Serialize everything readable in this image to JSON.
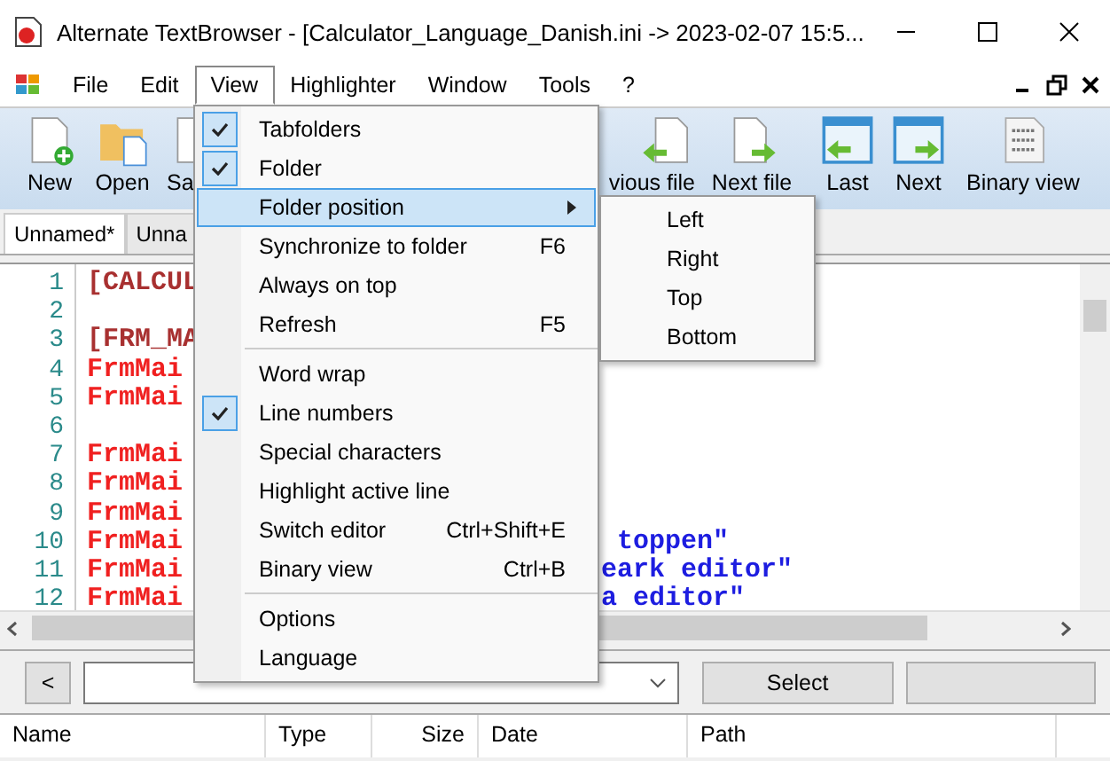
{
  "window": {
    "title": "Alternate TextBrowser - [Calculator_Language_Danish.ini -> 2023-02-07 15:5..."
  },
  "menubar": [
    {
      "label": "File",
      "selected": false
    },
    {
      "label": "Edit",
      "selected": false
    },
    {
      "label": "View",
      "selected": true
    },
    {
      "label": "Highlighter",
      "selected": false
    },
    {
      "label": "Window",
      "selected": false
    },
    {
      "label": "Tools",
      "selected": false
    },
    {
      "label": "?",
      "selected": false
    }
  ],
  "toolbar": [
    {
      "label": "New",
      "kind": "new"
    },
    {
      "label": "Open",
      "kind": "open"
    },
    {
      "label": "Sa",
      "kind": "doc"
    },
    {
      "label": "vious file",
      "kind": "prev"
    },
    {
      "label": "Next file",
      "kind": "next"
    },
    {
      "label": "Last",
      "kind": "last"
    },
    {
      "label": "Next",
      "kind": "nextw"
    },
    {
      "label": "Binary view",
      "kind": "binary"
    }
  ],
  "tabs": [
    {
      "label": "Unnamed*",
      "selected": true
    },
    {
      "label": "Unna",
      "selected": false
    }
  ],
  "editor": {
    "lines": [
      {
        "number": "1",
        "kind": "section",
        "left": "[CALCUL"
      },
      {
        "number": "2",
        "kind": "blank"
      },
      {
        "number": "3",
        "kind": "section",
        "left": "[FRM_MA"
      },
      {
        "number": "4",
        "kind": "key",
        "left": "FrmMai"
      },
      {
        "number": "5",
        "kind": "key",
        "left": "FrmMai"
      },
      {
        "number": "6",
        "kind": "blank"
      },
      {
        "number": "7",
        "kind": "key",
        "left": "FrmMai"
      },
      {
        "number": "8",
        "kind": "key",
        "left": "FrmMai"
      },
      {
        "number": "9",
        "kind": "key",
        "left": "FrmMai"
      },
      {
        "number": "10",
        "kind": "key",
        "left": "FrmMai",
        "right": " toppen\""
      },
      {
        "number": "11",
        "kind": "key",
        "left": "FrmMai",
        "right": "eark editor\""
      },
      {
        "number": "12",
        "kind": "key",
        "left": "FrmMai",
        "right": "a editor\""
      }
    ]
  },
  "view_menu": [
    {
      "kind": "check",
      "label": "Tabfolders",
      "checked": true,
      "selected": false
    },
    {
      "kind": "check",
      "label": "Folder",
      "checked": true,
      "selected": false
    },
    {
      "kind": "submenu",
      "label": "Folder position",
      "checked": false,
      "selected": true
    },
    {
      "kind": "check",
      "label": "Synchronize to folder",
      "shortcut": "F6",
      "checked": false,
      "selected": false
    },
    {
      "kind": "check",
      "label": "Always on top",
      "checked": false,
      "selected": false
    },
    {
      "kind": "check",
      "label": "Refresh",
      "shortcut": "F5",
      "checked": false,
      "selected": false
    },
    {
      "kind": "separator"
    },
    {
      "kind": "check",
      "label": "Word wrap",
      "checked": false,
      "selected": false
    },
    {
      "kind": "check",
      "label": "Line numbers",
      "checked": true,
      "selected": false
    },
    {
      "kind": "check",
      "label": "Special characters",
      "checked": false,
      "selected": false
    },
    {
      "kind": "check",
      "label": "Highlight active line",
      "checked": false,
      "selected": false
    },
    {
      "kind": "check",
      "label": "Switch editor",
      "shortcut": "Ctrl+Shift+E",
      "checked": false,
      "selected": false
    },
    {
      "kind": "check",
      "label": "Binary view",
      "shortcut": "Ctrl+B",
      "checked": false,
      "selected": false
    },
    {
      "kind": "separator"
    },
    {
      "kind": "check",
      "label": "Options",
      "checked": false,
      "selected": false
    },
    {
      "kind": "check",
      "label": "Language",
      "checked": false,
      "selected": false
    }
  ],
  "position_submenu": [
    {
      "label": "Left"
    },
    {
      "label": "Right"
    },
    {
      "label": "Top"
    },
    {
      "label": "Bottom"
    }
  ],
  "folder_bar": {
    "back": "<",
    "select": "Select"
  },
  "file_list": {
    "columns": [
      "Name",
      "Type",
      "Size",
      "Date",
      "Path"
    ]
  }
}
